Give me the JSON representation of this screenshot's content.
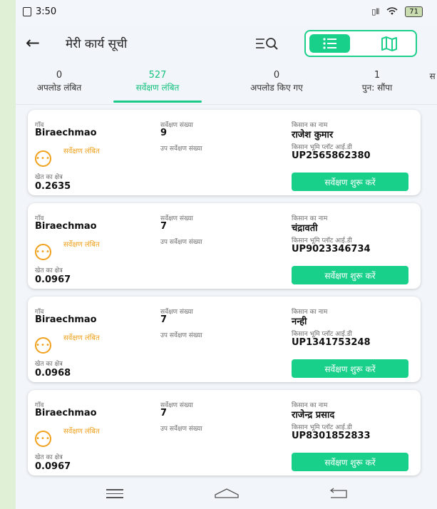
{
  "status_bar": {
    "time": "3:50",
    "battery": "71"
  },
  "header": {
    "title": "मेरी कार्य सूची"
  },
  "tabs": [
    {
      "count": "0",
      "label": "अपलोड लंबित"
    },
    {
      "count": "527",
      "label": "सर्वेक्षण लंबित",
      "active": true
    },
    {
      "count": "0",
      "label": "अपलोड किए गए"
    },
    {
      "count": "1",
      "label": "पुन: सौंपा"
    },
    {
      "count": "",
      "label": "स"
    }
  ],
  "labels": {
    "village": "गाँव",
    "survey_number": "सर्वेक्षण संख्या",
    "sub_survey_number": "उप सर्वेक्षण संख्या",
    "farmer_name": "किसान का नाम",
    "plot_id": "किसान भूमि प्लॉट आई.डी",
    "field_area": "खेत का क्षेत्र",
    "start_button": "सर्वेक्षण शुरू करें"
  },
  "status_color": "#f0a11d",
  "accent_color": "#19d08b",
  "records": [
    {
      "village": "Biraechmao",
      "survey_number": "9",
      "sub_survey_number": "",
      "farmer_name": "राजेश कुमार",
      "plot_id": "UP2565862380",
      "status": "सर्वेक्षण लंबित",
      "area": "0.2635"
    },
    {
      "village": "Biraechmao",
      "survey_number": "7",
      "sub_survey_number": "",
      "farmer_name": "चंद्रावती",
      "plot_id": "UP9023346734",
      "status": "सर्वेक्षण लंबित",
      "area": "0.0967"
    },
    {
      "village": "Biraechmao",
      "survey_number": "7",
      "sub_survey_number": "",
      "farmer_name": "नन्ही",
      "plot_id": "UP1341753248",
      "status": "सर्वेक्षण लंबित",
      "area": "0.0968"
    },
    {
      "village": "Biraechmao",
      "survey_number": "7",
      "sub_survey_number": "",
      "farmer_name": "राजेन्द्र प्रसाद",
      "plot_id": "UP8301852833",
      "status": "सर्वेक्षण लंबित",
      "area": "0.0967"
    }
  ]
}
